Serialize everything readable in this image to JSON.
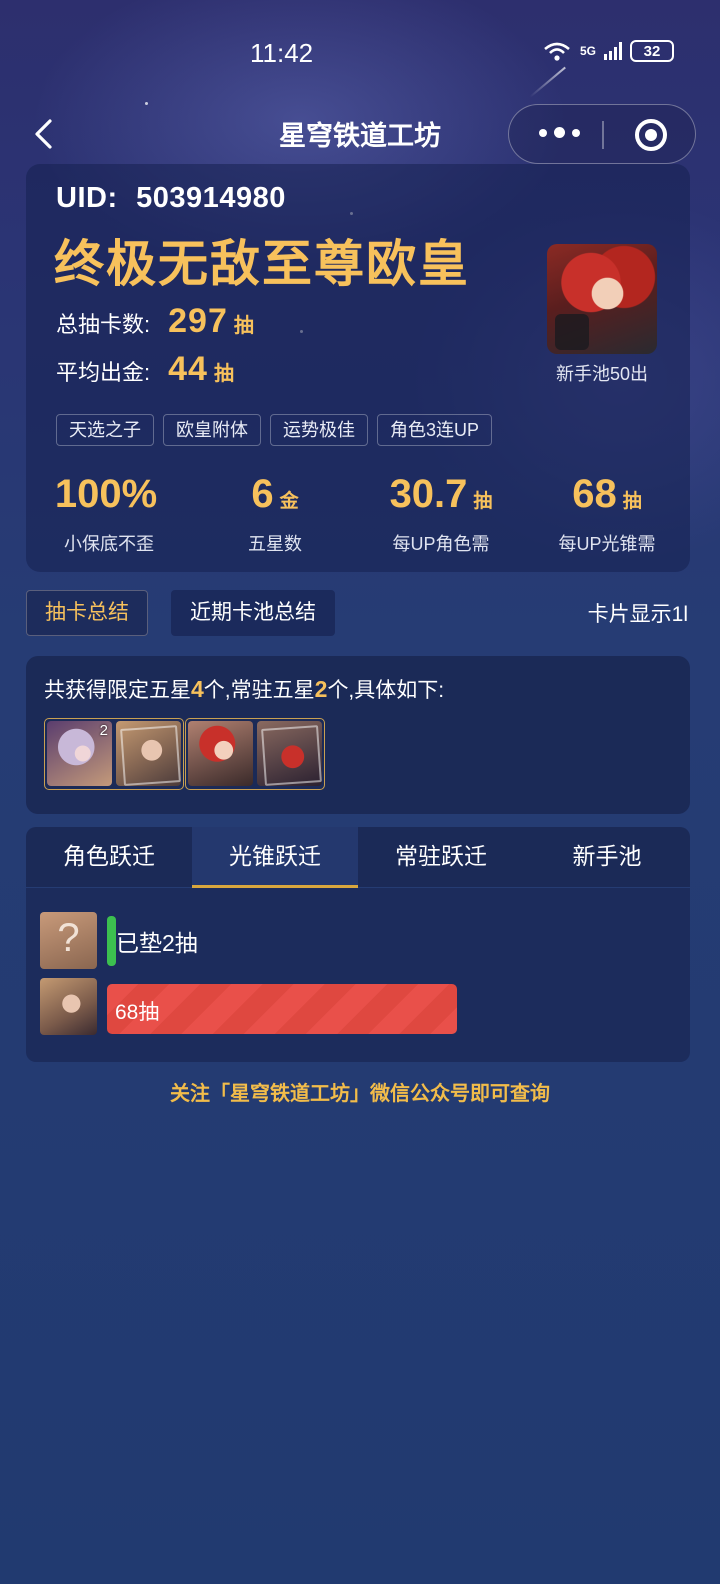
{
  "status_bar": {
    "time": "11:42",
    "battery": "32",
    "wifi_label": "6",
    "network": "5G"
  },
  "nav": {
    "title": "星穹铁道工坊"
  },
  "summary": {
    "uid_label": "UID:",
    "uid": "503914980",
    "rank_title": "终极无敌至尊欧皇",
    "total_pulls_label": "总抽卡数:",
    "total_pulls": "297",
    "avg_gold_label": "平均出金:",
    "avg_gold": "44",
    "pull_unit": "抽",
    "avatar_caption": "新手池50出",
    "tags": [
      "天选之子",
      "欧皇附体",
      "运势极佳",
      "角色3连UP"
    ],
    "stats": [
      {
        "value": "100%",
        "unit": "",
        "label": "小保底不歪"
      },
      {
        "value": "6",
        "unit": "金",
        "label": "五星数"
      },
      {
        "value": "30.7",
        "unit": "抽",
        "label": "每UP角色需"
      },
      {
        "value": "68",
        "unit": "抽",
        "label": "每UP光锥需"
      }
    ]
  },
  "view_tabs": {
    "active": "抽卡总结",
    "inactive": "近期卡池总结",
    "card_display": "卡片显示1l"
  },
  "obtained": {
    "prefix": "共获得限定五星",
    "limited_count": "4",
    "middle": "个,常驻五星",
    "standard_count": "2",
    "suffix": "个,具体如下:",
    "thumb_badge": "2"
  },
  "pool_tabs": [
    "角色跃迁",
    "光锥跃迁",
    "常驻跃迁",
    "新手池"
  ],
  "pool_active_index": 1,
  "progress": {
    "unknown_mark": "?",
    "pity_label": "已垫2抽",
    "pity_pulls": 2,
    "hit_label": "68抽",
    "hit_pulls": 68
  },
  "footer_note": "关注「星穹铁道工坊」微信公众号即可查询"
}
